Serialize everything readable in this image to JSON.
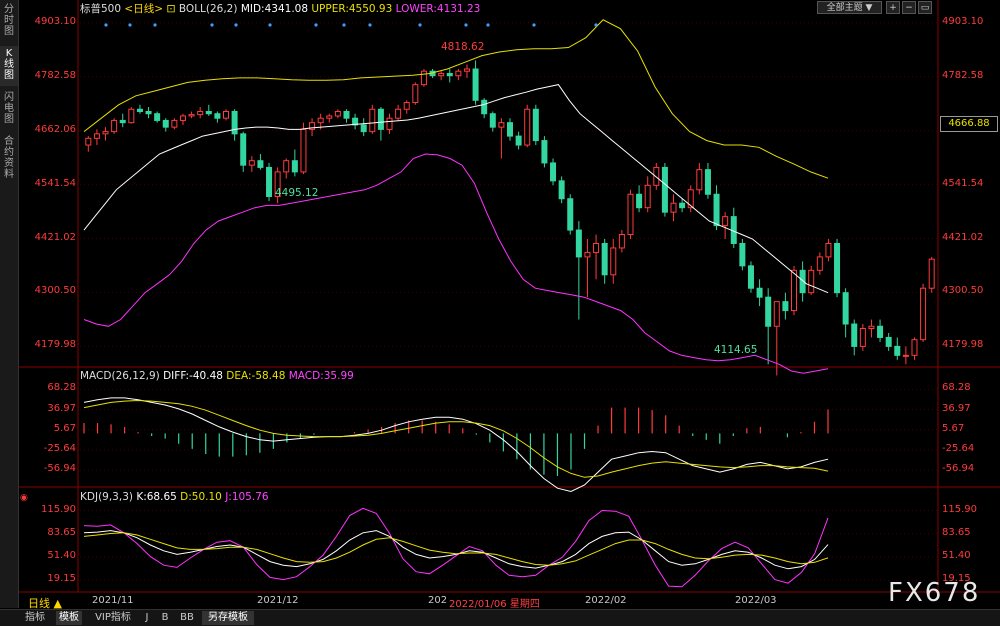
{
  "sidebar": {
    "tabs": [
      {
        "label": "分时图",
        "active": false
      },
      {
        "label": "K线图",
        "active": true
      },
      {
        "label": "闪电图",
        "active": false
      },
      {
        "label": "合约资料",
        "active": false
      }
    ]
  },
  "header": {
    "symbol": "标普500",
    "period": "<日线>",
    "indicator": "BOLL(26,2)",
    "mid": "MID:4341.08",
    "upper": "UPPER:4550.93",
    "lower": "LOWER:4131.23",
    "topic_button": "全部主题",
    "colors": {
      "mid": "#ffffff",
      "upper": "#e8e000",
      "lower": "#ff33ff"
    }
  },
  "macd_header": {
    "name": "MACD(26,12,9)",
    "diff": "DIFF:-40.48",
    "dea": "DEA:-58.48",
    "macd": "MACD:35.99"
  },
  "kdj_header": {
    "name": "KDJ(9,3,3)",
    "k": "K:68.65",
    "d": "D:50.10",
    "j": "J:105.76"
  },
  "price_ticks": [
    "4903.10",
    "4782.58",
    "4662.06",
    "4541.54",
    "4421.02",
    "4300.50",
    "4179.98"
  ],
  "current_price": "4666.88",
  "macd_ticks": [
    "68.28",
    "36.97",
    "5.67",
    "-25.64",
    "-56.94"
  ],
  "kdj_ticks": [
    "115.90",
    "83.65",
    "51.40",
    "19.15"
  ],
  "x_ticks": [
    "2021/11",
    "2021/12",
    "202",
    "2022/02",
    "2022/03"
  ],
  "crosshair_date": "2022/01/06 星期四",
  "annotations": {
    "high": "4818.62",
    "low1": "4495.12",
    "low2": "4114.65"
  },
  "bottom_bar": {
    "period_label": "日线",
    "tabs": [
      "指标",
      "模板",
      "VIP指标",
      "J",
      "B",
      "BB",
      "另存模板"
    ]
  },
  "watermark": "FX678",
  "chart_data": {
    "type": "candlestick",
    "ylim": [
      4110,
      4910
    ],
    "candles": [
      [
        4630,
        4650,
        4615,
        4645
      ],
      [
        4645,
        4665,
        4630,
        4655
      ],
      [
        4655,
        4670,
        4640,
        4660
      ],
      [
        4660,
        4690,
        4655,
        4685
      ],
      [
        4685,
        4700,
        4670,
        4680
      ],
      [
        4680,
        4715,
        4678,
        4710
      ],
      [
        4710,
        4720,
        4700,
        4705
      ],
      [
        4705,
        4715,
        4690,
        4700
      ],
      [
        4700,
        4705,
        4680,
        4685
      ],
      [
        4685,
        4690,
        4660,
        4670
      ],
      [
        4670,
        4690,
        4665,
        4685
      ],
      [
        4685,
        4700,
        4675,
        4695
      ],
      [
        4695,
        4705,
        4690,
        4698
      ],
      [
        4698,
        4715,
        4690,
        4705
      ],
      [
        4705,
        4720,
        4695,
        4700
      ],
      [
        4700,
        4705,
        4680,
        4690
      ],
      [
        4690,
        4710,
        4685,
        4705
      ],
      [
        4705,
        4710,
        4640,
        4655
      ],
      [
        4655,
        4660,
        4570,
        4585
      ],
      [
        4585,
        4605,
        4570,
        4595
      ],
      [
        4595,
        4610,
        4575,
        4580
      ],
      [
        4580,
        4590,
        4505,
        4515
      ],
      [
        4515,
        4580,
        4500,
        4570
      ],
      [
        4570,
        4600,
        4555,
        4595
      ],
      [
        4595,
        4620,
        4560,
        4570
      ],
      [
        4570,
        4680,
        4565,
        4665
      ],
      [
        4665,
        4690,
        4650,
        4680
      ],
      [
        4680,
        4700,
        4665,
        4690
      ],
      [
        4690,
        4700,
        4680,
        4695
      ],
      [
        4695,
        4710,
        4690,
        4705
      ],
      [
        4705,
        4710,
        4680,
        4690
      ],
      [
        4690,
        4700,
        4665,
        4675
      ],
      [
        4675,
        4690,
        4650,
        4660
      ],
      [
        4660,
        4720,
        4655,
        4710
      ],
      [
        4710,
        4715,
        4640,
        4665
      ],
      [
        4665,
        4700,
        4655,
        4690
      ],
      [
        4690,
        4720,
        4685,
        4710
      ],
      [
        4710,
        4730,
        4700,
        4725
      ],
      [
        4725,
        4770,
        4720,
        4765
      ],
      [
        4765,
        4800,
        4760,
        4795
      ],
      [
        4795,
        4800,
        4780,
        4785
      ],
      [
        4785,
        4795,
        4775,
        4790
      ],
      [
        4790,
        4800,
        4770,
        4785
      ],
      [
        4785,
        4800,
        4775,
        4795
      ],
      [
        4795,
        4810,
        4780,
        4800
      ],
      [
        4800,
        4819,
        4720,
        4730
      ],
      [
        4730,
        4735,
        4690,
        4700
      ],
      [
        4700,
        4705,
        4660,
        4670
      ],
      [
        4670,
        4690,
        4600,
        4680
      ],
      [
        4680,
        4690,
        4640,
        4650
      ],
      [
        4650,
        4660,
        4620,
        4630
      ],
      [
        4630,
        4720,
        4625,
        4710
      ],
      [
        4710,
        4720,
        4630,
        4640
      ],
      [
        4640,
        4650,
        4580,
        4590
      ],
      [
        4590,
        4600,
        4540,
        4550
      ],
      [
        4550,
        4560,
        4500,
        4510
      ],
      [
        4510,
        4520,
        4430,
        4440
      ],
      [
        4440,
        4460,
        4240,
        4380
      ],
      [
        4380,
        4420,
        4290,
        4390
      ],
      [
        4390,
        4430,
        4330,
        4410
      ],
      [
        4410,
        4420,
        4320,
        4340
      ],
      [
        4340,
        4420,
        4320,
        4400
      ],
      [
        4400,
        4440,
        4390,
        4430
      ],
      [
        4430,
        4530,
        4420,
        4520
      ],
      [
        4520,
        4540,
        4480,
        4490
      ],
      [
        4490,
        4560,
        4480,
        4540
      ],
      [
        4540,
        4590,
        4530,
        4580
      ],
      [
        4580,
        4590,
        4470,
        4480
      ],
      [
        4480,
        4520,
        4460,
        4500
      ],
      [
        4500,
        4510,
        4480,
        4490
      ],
      [
        4490,
        4540,
        4480,
        4530
      ],
      [
        4530,
        4590,
        4520,
        4575
      ],
      [
        4575,
        4590,
        4510,
        4520
      ],
      [
        4520,
        4540,
        4440,
        4450
      ],
      [
        4450,
        4480,
        4420,
        4470
      ],
      [
        4470,
        4490,
        4400,
        4410
      ],
      [
        4410,
        4420,
        4350,
        4360
      ],
      [
        4360,
        4370,
        4300,
        4310
      ],
      [
        4310,
        4330,
        4270,
        4290
      ],
      [
        4290,
        4310,
        4140,
        4225
      ],
      [
        4225,
        4280,
        4115,
        4280
      ],
      [
        4280,
        4300,
        4240,
        4260
      ],
      [
        4260,
        4360,
        4250,
        4350
      ],
      [
        4350,
        4370,
        4280,
        4300
      ],
      [
        4300,
        4360,
        4295,
        4350
      ],
      [
        4350,
        4390,
        4340,
        4380
      ],
      [
        4380,
        4420,
        4370,
        4410
      ],
      [
        4410,
        4420,
        4290,
        4300
      ],
      [
        4300,
        4310,
        4200,
        4230
      ],
      [
        4230,
        4240,
        4160,
        4180
      ],
      [
        4180,
        4230,
        4170,
        4220
      ],
      [
        4220,
        4240,
        4200,
        4225
      ],
      [
        4225,
        4240,
        4190,
        4200
      ],
      [
        4200,
        4210,
        4170,
        4180
      ],
      [
        4180,
        4200,
        4150,
        4160
      ],
      [
        4160,
        4180,
        4140,
        4160
      ],
      [
        4160,
        4200,
        4150,
        4195
      ],
      [
        4195,
        4320,
        4190,
        4310
      ],
      [
        4310,
        4380,
        4300,
        4375
      ]
    ],
    "boll_mid": [
      4440,
      4470,
      4500,
      4530,
      4550,
      4570,
      4590,
      4610,
      4620,
      4630,
      4640,
      4650,
      4655,
      4660,
      4665,
      4668,
      4670,
      4670,
      4668,
      4665,
      4665,
      4668,
      4670,
      4672,
      4674,
      4676,
      4678,
      4680,
      4682,
      4684,
      4686,
      4690,
      4695,
      4700,
      4705,
      4710,
      4715,
      4720,
      4728,
      4736,
      4742,
      4748,
      4755,
      4760,
      4765,
      4730,
      4700,
      4680,
      4660,
      4640,
      4620,
      4600,
      4580,
      4560,
      4540,
      4520,
      4500,
      4480,
      4460,
      4450,
      4440,
      4430,
      4420,
      4400,
      4380,
      4360,
      4340,
      4320,
      4310,
      4300
    ],
    "boll_upper": [
      4660,
      4690,
      4720,
      4740,
      4750,
      4760,
      4770,
      4775,
      4778,
      4780,
      4780,
      4778,
      4776,
      4775,
      4775,
      4776,
      4780,
      4782,
      4784,
      4786,
      4790,
      4800,
      4815,
      4830,
      4838,
      4843,
      4845,
      4845,
      4848,
      4870,
      4910,
      4890,
      4840,
      4760,
      4700,
      4660,
      4640,
      4630,
      4630,
      4625,
      4605,
      4588,
      4570,
      4556
    ],
    "boll_lower": [
      4240,
      4230,
      4225,
      4240,
      4270,
      4300,
      4320,
      4340,
      4370,
      4410,
      4440,
      4460,
      4470,
      4480,
      4490,
      4495,
      4495,
      4500,
      4505,
      4510,
      4515,
      4520,
      4525,
      4530,
      4540,
      4555,
      4570,
      4600,
      4610,
      4608,
      4600,
      4585,
      4545,
      4480,
      4420,
      4370,
      4330,
      4310,
      4305,
      4300,
      4295,
      4290,
      4280,
      4270,
      4260,
      4240,
      4210,
      4190,
      4170,
      4160,
      4155,
      4150,
      4148,
      4150,
      4155,
      4160,
      4150,
      4140,
      4125,
      4120,
      4125,
      4130
    ],
    "macd_diff": [
      48,
      52,
      55,
      55,
      52,
      48,
      44,
      38,
      30,
      20,
      10,
      2,
      -5,
      -10,
      -12,
      -10,
      -8,
      -6,
      -5,
      -5,
      -3,
      0,
      5,
      12,
      18,
      22,
      25,
      25,
      22,
      15,
      5,
      -10,
      -28,
      -50,
      -70,
      -85,
      -90,
      -80,
      -60,
      -40,
      -35,
      -30,
      -28,
      -30,
      -40,
      -50,
      -55,
      -60,
      -55,
      -48,
      -45,
      -50,
      -55,
      -52,
      -45,
      -40
    ],
    "macd_dea": [
      40,
      44,
      48,
      50,
      51,
      50,
      48,
      46,
      42,
      36,
      28,
      20,
      12,
      5,
      0,
      -3,
      -4,
      -5,
      -5,
      -5,
      -4,
      -3,
      0,
      4,
      8,
      12,
      16,
      18,
      18,
      16,
      12,
      4,
      -8,
      -22,
      -38,
      -52,
      -62,
      -68,
      -66,
      -60,
      -55,
      -50,
      -46,
      -44,
      -46,
      -48,
      -50,
      -52,
      -53,
      -52,
      -50,
      -50,
      -52,
      -53,
      -54,
      -58.48
    ],
    "kdj_k": [
      85,
      86,
      88,
      85,
      78,
      68,
      60,
      55,
      58,
      62,
      66,
      68,
      65,
      55,
      45,
      40,
      38,
      42,
      48,
      60,
      75,
      85,
      88,
      80,
      65,
      55,
      50,
      52,
      55,
      60,
      58,
      50,
      42,
      38,
      36,
      40,
      45,
      55,
      70,
      80,
      85,
      86,
      75,
      60,
      45,
      40,
      42,
      48,
      55,
      60,
      58,
      50,
      40,
      35,
      38,
      48,
      68.65
    ],
    "kdj_d": [
      80,
      82,
      84,
      85,
      82,
      76,
      70,
      64,
      62,
      62,
      63,
      65,
      65,
      62,
      56,
      50,
      45,
      44,
      45,
      50,
      58,
      68,
      76,
      78,
      73,
      67,
      61,
      58,
      56,
      57,
      57,
      55,
      50,
      45,
      41,
      40,
      42,
      46,
      54,
      62,
      70,
      75,
      75,
      70,
      62,
      55,
      50,
      49,
      51,
      54,
      55,
      54,
      50,
      45,
      42,
      44,
      50.1
    ],
    "kdj_j": [
      95,
      94,
      96,
      85,
      70,
      52,
      40,
      37,
      50,
      62,
      72,
      74,
      65,
      41,
      23,
      20,
      24,
      38,
      54,
      80,
      109,
      119,
      112,
      84,
      49,
      31,
      28,
      40,
      53,
      66,
      60,
      40,
      26,
      24,
      26,
      40,
      51,
      73,
      102,
      116,
      115,
      108,
      75,
      40,
      11,
      10,
      26,
      46,
      63,
      72,
      64,
      42,
      20,
      15,
      30,
      56,
      105.76
    ],
    "x_tick_labels": [
      "2021/11",
      "2021/12",
      "202",
      "2022/02",
      "2022/03"
    ]
  }
}
